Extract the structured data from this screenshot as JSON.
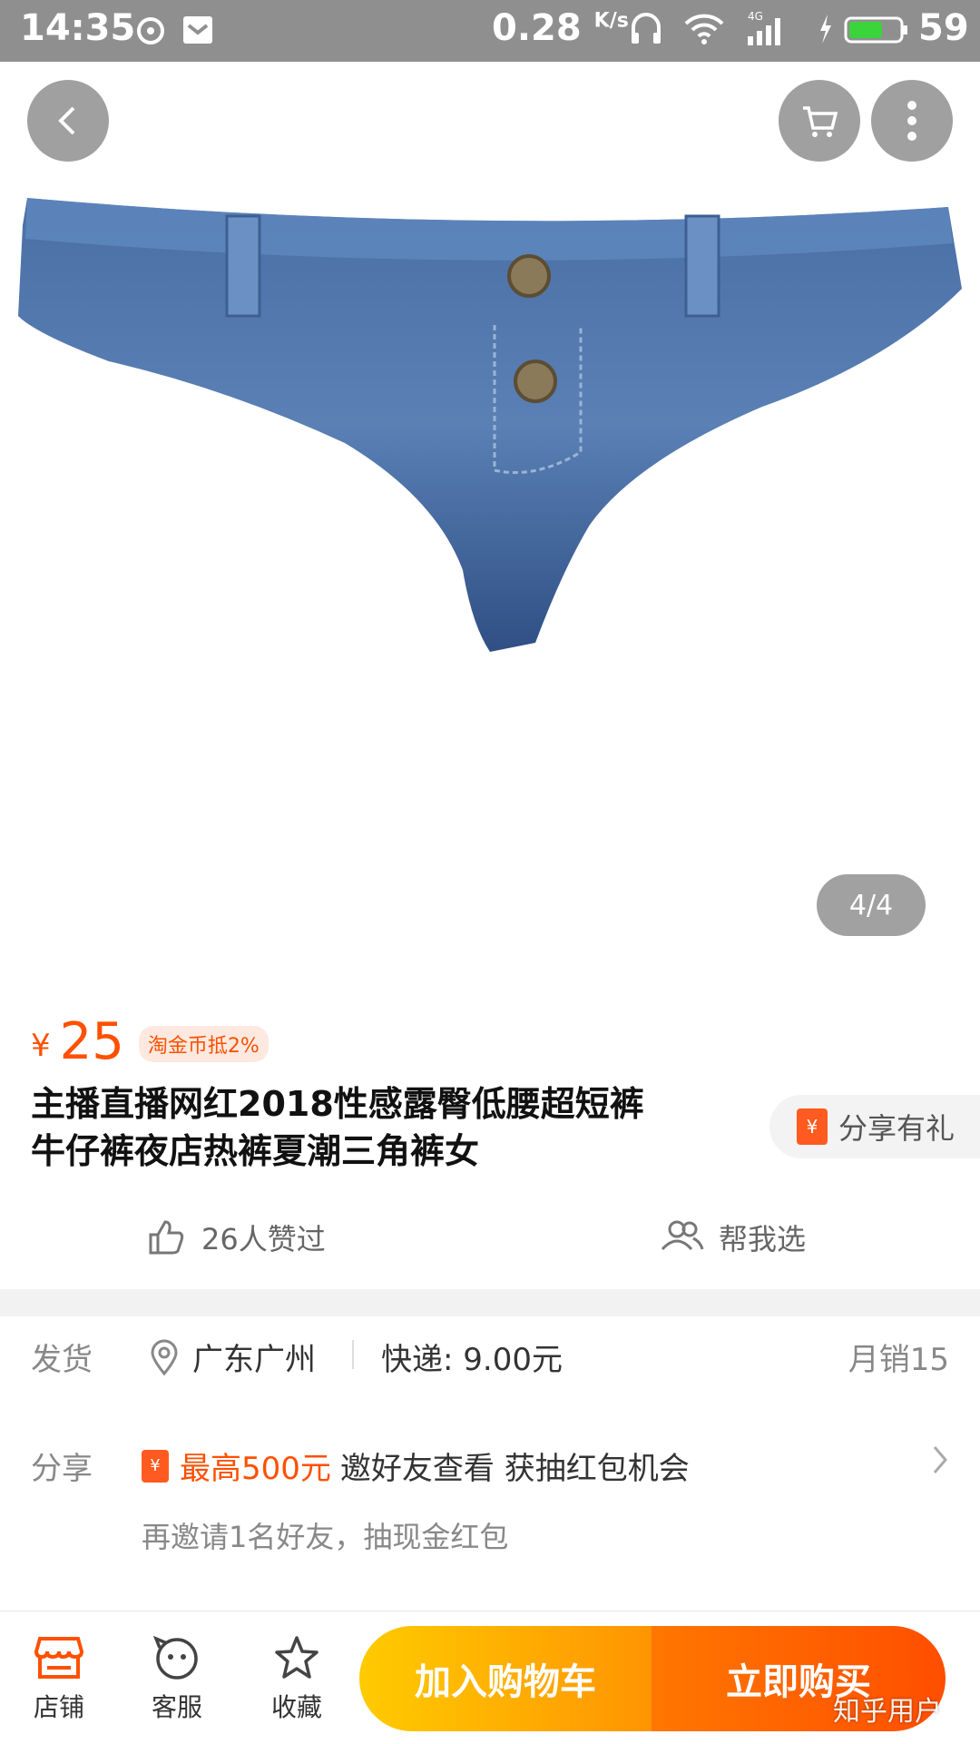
{
  "status_bar": {
    "time": "14:35",
    "speed": "0.28",
    "speed_unit": "K/s",
    "network": "4G",
    "battery": "59"
  },
  "gallery": {
    "counter": "4/4"
  },
  "product": {
    "price_symbol": "¥",
    "price": "25",
    "coin_tag": "淘金币抵2%",
    "title_line1": "主播直播网红2018性感露臀低腰超短裤",
    "title_line2": "牛仔裤夜店热裤夏潮三角裤女",
    "share_gift": "分享有礼",
    "share_gift_icon_char": "¥"
  },
  "social": {
    "likes": "26人赞过",
    "help_pick": "帮我选"
  },
  "shipping": {
    "label": "发货",
    "location": "广东广州",
    "fee": "快递: 9.00元",
    "monthly_sales": "月销15"
  },
  "share": {
    "label": "分享",
    "highlight": "最高500元",
    "text": "邀好友查看 获抽红包机会",
    "sub": "再邀请1名好友，抽现金红包"
  },
  "bottom_bar": {
    "store": "店铺",
    "service": "客服",
    "favorite": "收藏",
    "add_to_cart": "加入购物车",
    "buy_now": "立即购买"
  },
  "watermark": "知乎用户",
  "colors": {
    "accent": "#ff5000",
    "cart_button": "#ffb000",
    "buy_button": "#ff5a00",
    "status_bar": "#8f8f8f"
  }
}
